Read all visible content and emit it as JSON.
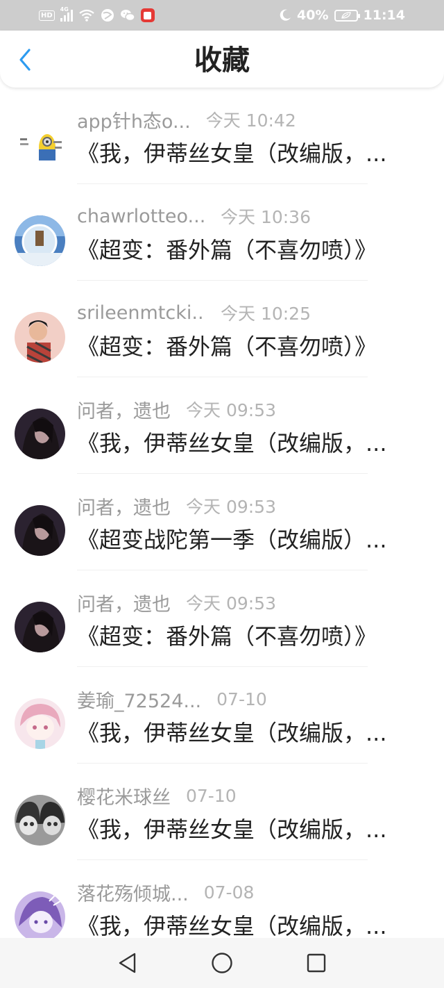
{
  "status_bar": {
    "hd": "HD",
    "signal_label": "4G",
    "battery": "40%",
    "time": "11:14"
  },
  "header": {
    "title": "收藏"
  },
  "favorites": [
    {
      "name": "app针h态o...",
      "time": "今天 10:42",
      "title": "《我，伊蒂丝女皇（改编版，..."
    },
    {
      "name": "chawrlotteo...",
      "time": "今天 10:36",
      "title": "《超变：番外篇（不喜勿喷）》"
    },
    {
      "name": "srileenmtcki...",
      "time": "今天 10:25",
      "title": "《超变：番外篇（不喜勿喷）》"
    },
    {
      "name": "问者，遗也",
      "time": "今天 09:53",
      "title": "《我，伊蒂丝女皇（改编版，..."
    },
    {
      "name": "问者，遗也",
      "time": "今天 09:53",
      "title": "《超变战陀第一季（改编版）..."
    },
    {
      "name": "问者，遗也",
      "time": "今天 09:53",
      "title": "《超变：番外篇（不喜勿喷）》"
    },
    {
      "name": "姜瑜_72524...",
      "time": "07-10",
      "title": "《我，伊蒂丝女皇（改编版，..."
    },
    {
      "name": "樱花米球丝",
      "time": "07-10",
      "title": "《我，伊蒂丝女皇（改编版，..."
    },
    {
      "name": "落花殇倾城...",
      "time": "07-08",
      "title": "《我，伊蒂丝女皇（改编版，..."
    }
  ],
  "colors": {
    "accent": "#2d9bf0",
    "status_bar_bg": "#cdcdcd",
    "name_text": "#9a9a9a",
    "time_text": "#b4b4b4",
    "title_text": "#222222"
  },
  "icons": {
    "back": "chevron-left-icon",
    "nav_back": "triangle-back-icon",
    "nav_home": "circle-home-icon",
    "nav_recents": "square-recents-icon"
  }
}
